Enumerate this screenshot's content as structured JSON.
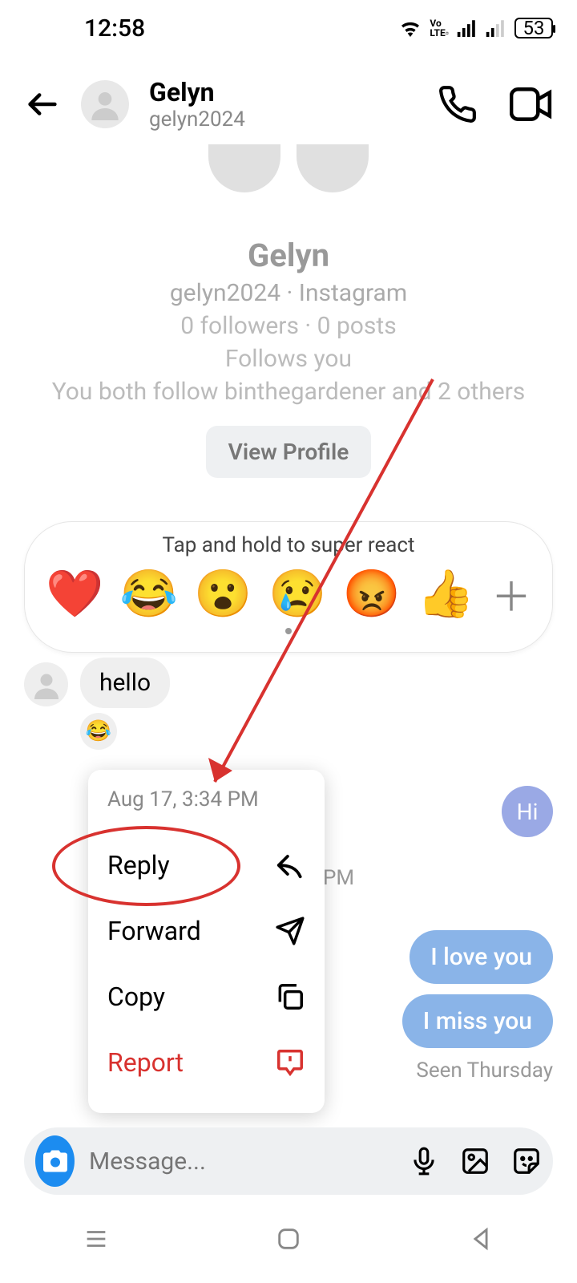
{
  "status": {
    "time": "12:58",
    "battery": "53"
  },
  "header": {
    "name": "Gelyn",
    "username": "gelyn2024"
  },
  "profile": {
    "name": "Gelyn",
    "sub": "gelyn2024 · Instagram",
    "stats": "0 followers · 0 posts",
    "follows": "Follows you",
    "mutual": "You both follow binthegardener and 2 others",
    "view_btn": "View Profile"
  },
  "react": {
    "hint": "Tap and hold to super react",
    "emojis": [
      "❤️",
      "😂",
      "😮",
      "😢",
      "😡",
      "👍"
    ]
  },
  "messages": {
    "in1": "hello",
    "in1_reaction": "😂",
    "out_hi": "Hi",
    "time_pm": "PM",
    "out2": "I love you",
    "out3": "I miss you",
    "seen": "Seen Thursday"
  },
  "ctx": {
    "time": "Aug 17, 3:34 PM",
    "reply": "Reply",
    "forward": "Forward",
    "copy": "Copy",
    "report": "Report"
  },
  "input": {
    "placeholder": "Message..."
  }
}
